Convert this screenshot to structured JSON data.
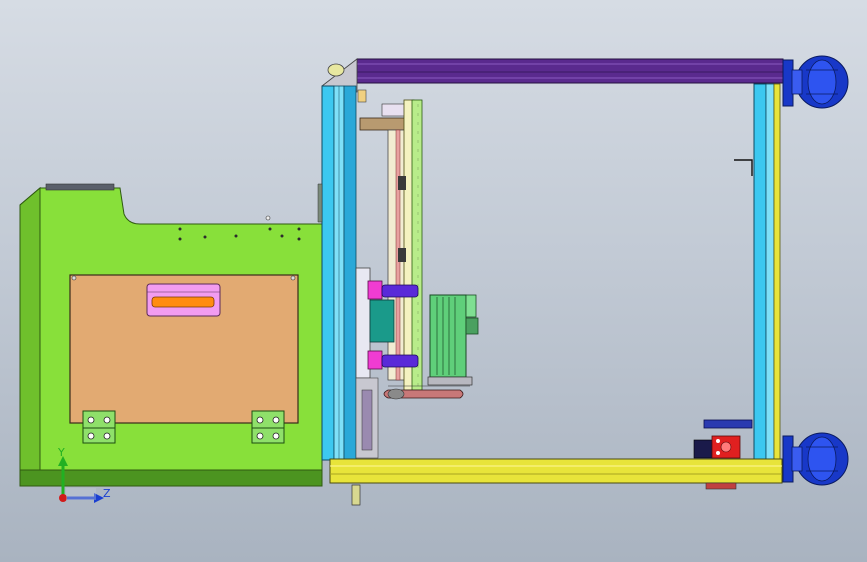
{
  "window": {
    "title": ""
  },
  "viewport": {
    "background_top": "#d6dce4",
    "background_bottom": "#a9b3c0"
  },
  "triad": {
    "y_label": "Y",
    "z_label": "Z",
    "x_color": "#d11a1a",
    "y_color": "#22b022",
    "z_color": "#1a3fd1"
  },
  "model": {
    "colors": {
      "housing_green": "#88e03a",
      "panel_tan": "#e2aa72",
      "handle_pink": "#f29cf0",
      "handle_orange": "#ff8c10",
      "frame_cyan": "#3cc8f0",
      "frame_yellow": "#e8e43a",
      "top_beam_purple": "#5a2a8e",
      "wheel_blue": "#1838c8",
      "motor_green": "#5fcf7a",
      "clamp_magenta": "#f03cd2",
      "pin_purple": "#5a2ad8",
      "valve_red": "#e02020"
    }
  }
}
